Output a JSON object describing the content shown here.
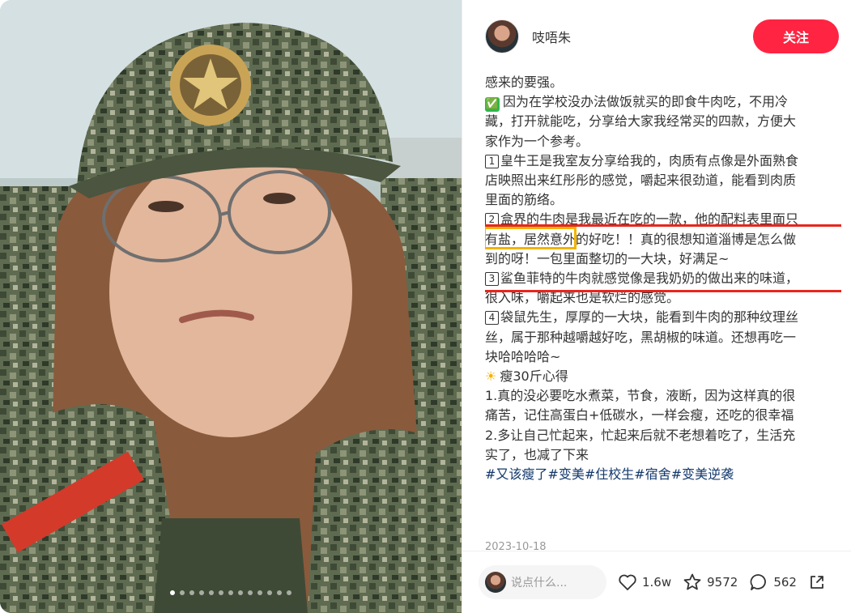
{
  "author": {
    "name": "吱唔朱",
    "follow_label": "关注"
  },
  "note": {
    "lines": [
      "感来的要强。",
      "因为在学校没办法做饭就买的即食牛肉吃，不用冷",
      "藏，打开就能吃，分享给大家我经常买的四款，方便大",
      "家作为一个参考。",
      "皇牛王是我室友分享给我的，肉质有点像是外面熟食",
      "店映照出来红彤彤的感觉，嚼起来很劲道，能看到肉质",
      "里面的筋络。",
      "盒界的牛肉是我最近在吃的一款，他的配料表里面只",
      "有盐，居然意外的好吃！！真的很想知道淄博是怎么做",
      "到的呀！一包里面整切的一大块，好满足~",
      "鲨鱼菲特的牛肉就感觉像是我奶奶的做出来的味道，",
      "很入味，嚼起来也是软烂的感觉。",
      "袋鼠先生，厚厚的一大块，能看到牛肉的那种纹理丝",
      "丝，属于那种越嚼越好吃，黑胡椒的味道。还想再吃一",
      "块哈哈哈哈~",
      "瘦30斤心得",
      "1.真的没必要吃水煮菜，节食，液断，因为这样真的很",
      "痛苦，记住高蛋白+低碳水，一样会瘦，还吃的很幸福",
      "2.多让自己忙起来，忙起来后就不老想着吃了，生活充",
      "实了，也减了下来"
    ],
    "markers": {
      "l1": "✅",
      "l4": "1",
      "l7": "2",
      "l10": "3",
      "l12": "4",
      "l15": "☀"
    },
    "tags": [
      "#又该瘦了",
      "#变美",
      "#住校生",
      "#宿舍",
      "#变美逆袭"
    ],
    "date": "2023-10-18"
  },
  "footer": {
    "comment_placeholder": "说点什么...",
    "likes": "1.6w",
    "favorites": "9572",
    "comments": "562"
  },
  "carousel": {
    "count": 13,
    "active_index": 0
  },
  "colors": {
    "accent": "#ff2442",
    "tag": "#13386c",
    "highlight_red": "#e8261f",
    "highlight_yellow": "#f3b400"
  }
}
